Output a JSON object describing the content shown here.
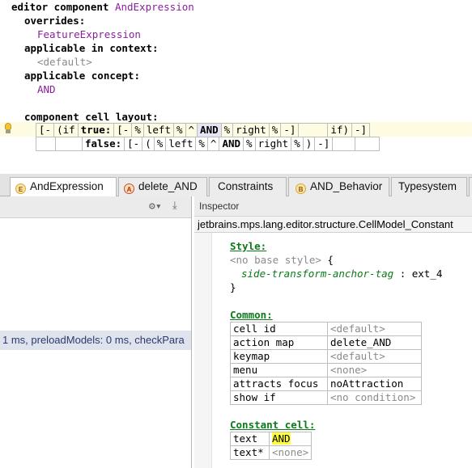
{
  "editor": {
    "line1_kw": "editor component",
    "line1_name": "AndExpression",
    "overrides_label": "overrides:",
    "overrides_value": "FeatureExpression",
    "context_label": "applicable in context:",
    "context_value": "<default>",
    "concept_label": "applicable concept:",
    "concept_value": "AND",
    "layout_label": "component cell layout:",
    "row1": {
      "c1": "[-",
      "c2": "(if",
      "c3": "true:",
      "c4": "[-",
      "c5": "%",
      "c6": "left",
      "c7": "%",
      "c8": "^",
      "c9": "AND",
      "c10": "%",
      "c11": "right",
      "c12": "%",
      "c13": "-]",
      "c14": "",
      "c15": "if)",
      "c16": "-]"
    },
    "row2": {
      "c3": "false:",
      "c4": "[-",
      "c5": "(",
      "c6": "%",
      "c7": "left",
      "c8": "%",
      "c9": "^",
      "c10": "AND",
      "c11": "%",
      "c12": "right",
      "c13": "%",
      "c14": ")",
      "c15": "-]"
    }
  },
  "tabs": [
    {
      "label": "AndExpression",
      "icon": "E"
    },
    {
      "label": "delete_AND",
      "icon": "A"
    },
    {
      "label": "Constraints",
      "icon": ""
    },
    {
      "label": "AND_Behavior",
      "icon": "B"
    },
    {
      "label": "Typesystem",
      "icon": ""
    }
  ],
  "left_pane": {
    "status_text": "1 ms, preloadModels: 0 ms, checkPara"
  },
  "inspector": {
    "title": "Inspector",
    "path": "jetbrains.mps.lang.editor.structure.CellModel_Constant",
    "style_header": "Style:",
    "no_base_style": "<no base style>",
    "open_brace": "{",
    "style_key": "side-transform-anchor-tag",
    "style_colon": ":",
    "style_value": "ext_4",
    "close_brace": "}",
    "common_header": "Common:",
    "common_rows": [
      {
        "key": "cell id",
        "value": "<default>"
      },
      {
        "key": "action map",
        "value": "delete_AND"
      },
      {
        "key": "keymap",
        "value": "<default>"
      },
      {
        "key": "menu",
        "value": "<none>"
      },
      {
        "key": "attracts focus",
        "value": "noAttraction"
      },
      {
        "key": "show if",
        "value": "<no condition>"
      }
    ],
    "constant_header": "Constant cell:",
    "constant_rows": [
      {
        "key": "text",
        "value": "AND"
      },
      {
        "key": "text*",
        "value": "<none>"
      }
    ]
  },
  "colors": {
    "purple": "#8a1f9c",
    "green": "#0b7a1a",
    "highlight": "#ffff3a",
    "row_highlight": "#fdfbe1"
  }
}
